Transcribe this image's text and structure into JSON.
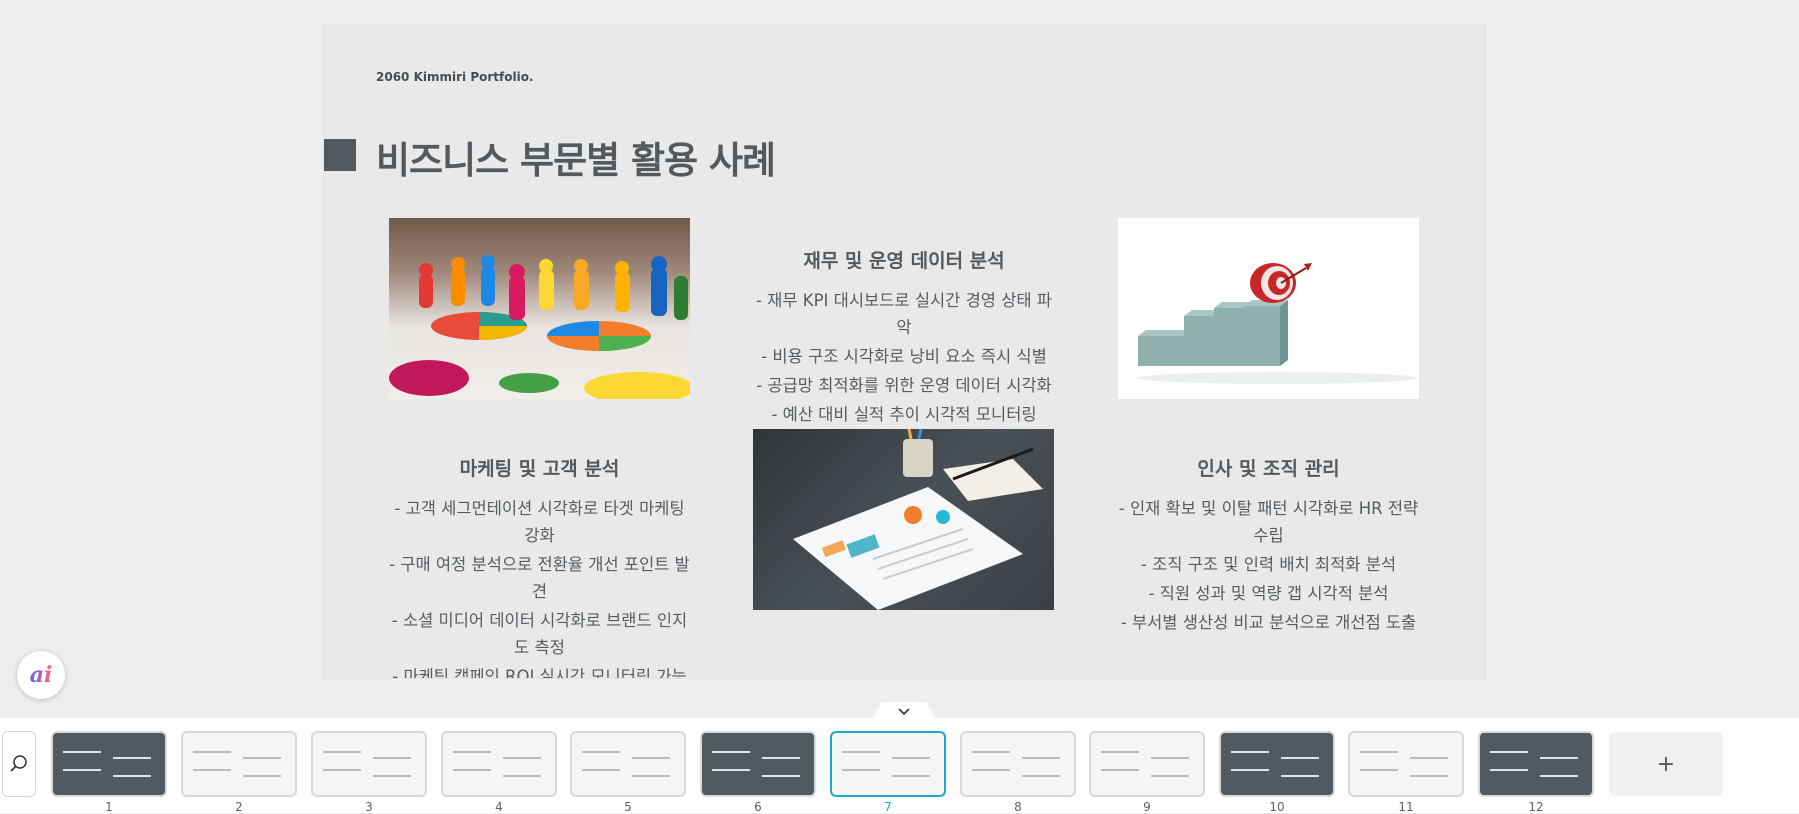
{
  "slide": {
    "brand": "2060 Kimmiri Portfolio.",
    "title": "비즈니스 부문별 활용 사례",
    "sections": [
      {
        "heading": "마케팅 및 고객 분석",
        "bullets": [
          "- 고객 세그먼테이션 시각화로 타겟 마케팅 강화",
          "- 구매 여정 분석으로 전환율 개선 포인트 발견",
          "- 소셜 미디어 데이터 시각화로 브랜드 인지도 측정",
          "- 마케팅 캠페인 ROI 실시간 모니터링 가능"
        ]
      },
      {
        "heading": "재무 및 운영 데이터 분석",
        "bullets": [
          "- 재무 KPI 대시보드로 실시간 경영 상태 파악",
          "- 비용 구조 시각화로 낭비 요소 즉시 식별",
          "- 공급망 최적화를 위한 운영 데이터 시각화",
          "- 예산 대비 실적 추이 시각적 모니터링"
        ]
      },
      {
        "heading": "인사 및 조직 관리",
        "bullets": [
          "- 인재 확보 및 이탈 패턴 시각화로 HR 전략 수립",
          "- 조직 구조 및 인력 배치 최적화 분석",
          "- 직원 성과 및 역량 갭 시각적 분석",
          "- 부서별 생산성 비교 분석으로 개선점 도출"
        ]
      }
    ]
  },
  "ai_button": {
    "label": "ai"
  },
  "add_slide": {
    "label": "+"
  },
  "filmstrip": {
    "active_index": 7,
    "slides": [
      {
        "num": "1",
        "theme": "dark"
      },
      {
        "num": "2",
        "theme": "light"
      },
      {
        "num": "3",
        "theme": "light"
      },
      {
        "num": "4",
        "theme": "light"
      },
      {
        "num": "5",
        "theme": "light"
      },
      {
        "num": "6",
        "theme": "dark"
      },
      {
        "num": "7",
        "theme": "light"
      },
      {
        "num": "8",
        "theme": "light"
      },
      {
        "num": "9",
        "theme": "light"
      },
      {
        "num": "10",
        "theme": "dark"
      },
      {
        "num": "11",
        "theme": "light"
      },
      {
        "num": "12",
        "theme": "dark"
      }
    ]
  },
  "colors": {
    "accent": "#19a8c6",
    "slide_dark": "#525a5f",
    "slide_bg": "#e9e9e9"
  },
  "icons": {
    "search": "search-zoom-icon",
    "collapse": "chevron-down-icon",
    "add": "plus-icon"
  }
}
